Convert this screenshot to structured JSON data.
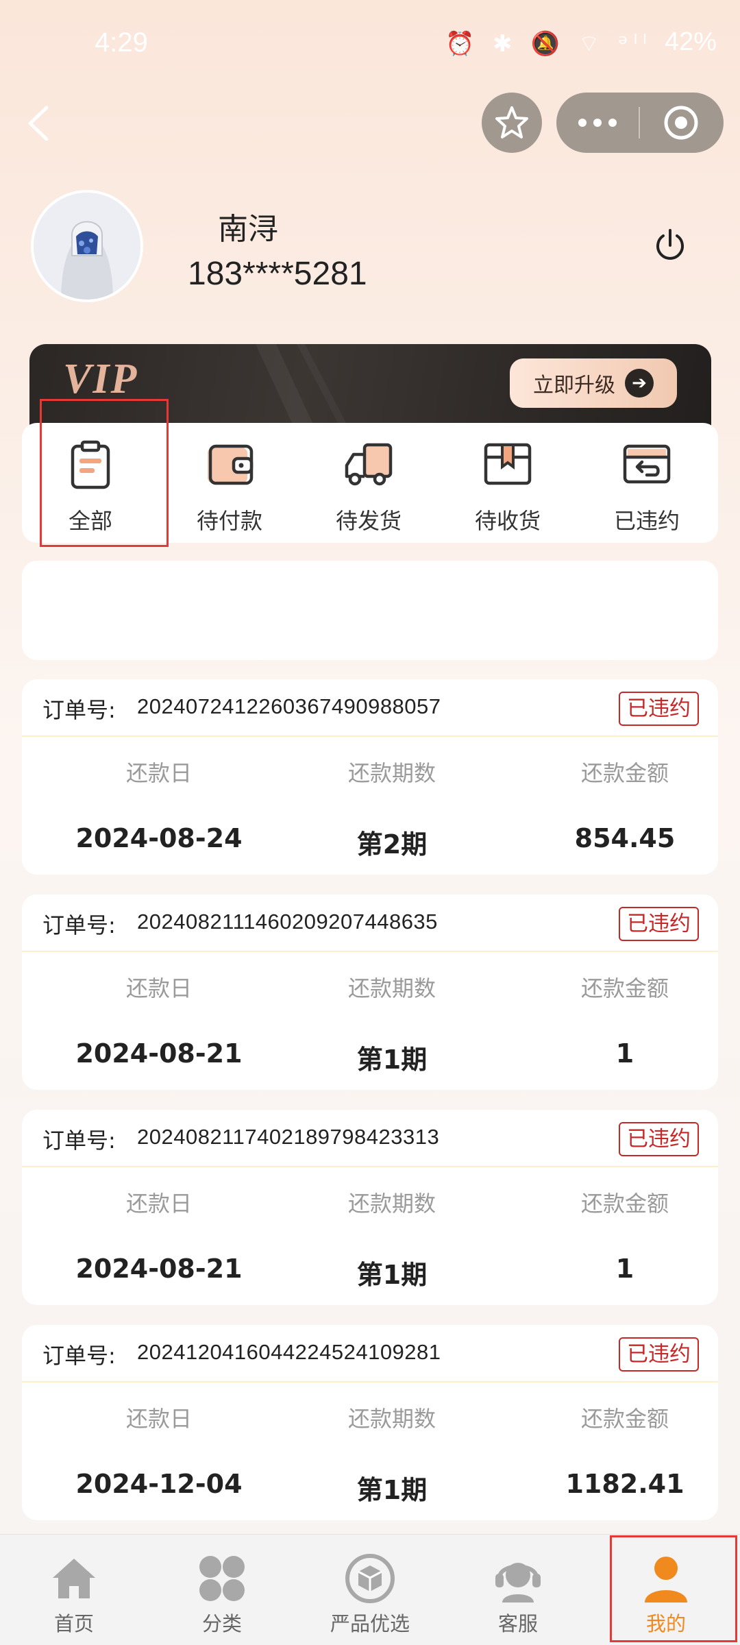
{
  "status_bar": {
    "time": "4:29",
    "battery": "42%",
    "icons": "⏰ ✱ 🔕 ⌔ ᵊˡˡ"
  },
  "colors": {
    "accent": "#f08a1e",
    "badge": "#c62828",
    "highlight": "#e53935"
  },
  "nav": {
    "back_icon": "chevron-left-icon",
    "fav_icon": "star-icon",
    "more_icon": "more-dots-icon",
    "target_icon": "target-icon"
  },
  "profile": {
    "name": "南浔",
    "phone": "183****5281"
  },
  "vip": {
    "logo": "VIP",
    "upgrade_label": "立即升级"
  },
  "order_tabs": [
    {
      "label": "全部",
      "icon": "clipboard-icon",
      "selected": true
    },
    {
      "label": "待付款",
      "icon": "wallet-icon"
    },
    {
      "label": "待发货",
      "icon": "truck-icon"
    },
    {
      "label": "待收货",
      "icon": "box-icon"
    },
    {
      "label": "已违约",
      "icon": "return-icon"
    }
  ],
  "orders": {
    "no_label": "订单号:",
    "col_date": "还款日",
    "col_period": "还款期数",
    "col_amount": "还款金额",
    "items": [
      {
        "no": "20240724122603674909880​57",
        "status": "已违约",
        "date": "2024-08-24",
        "period": "第2期",
        "amount": "854.45"
      },
      {
        "no": "20240821114602092074486​35",
        "status": "已违约",
        "date": "2024-08-21",
        "period": "第1期",
        "amount": "1"
      },
      {
        "no": "20240821174021897984233​13",
        "status": "已违约",
        "date": "2024-08-21",
        "period": "第1期",
        "amount": "1"
      },
      {
        "no": "20241204160442245241092​81",
        "status": "已违约",
        "date": "2024-12-04",
        "period": "第1期",
        "amount": "1182.41"
      }
    ]
  },
  "bottom_nav": [
    {
      "label": "首页",
      "icon": "home-icon"
    },
    {
      "label": "分类",
      "icon": "category-icon"
    },
    {
      "label": "严品优选",
      "icon": "cube-icon"
    },
    {
      "label": "客服",
      "icon": "headset-icon"
    },
    {
      "label": "我的",
      "icon": "user-icon",
      "active": true
    }
  ]
}
